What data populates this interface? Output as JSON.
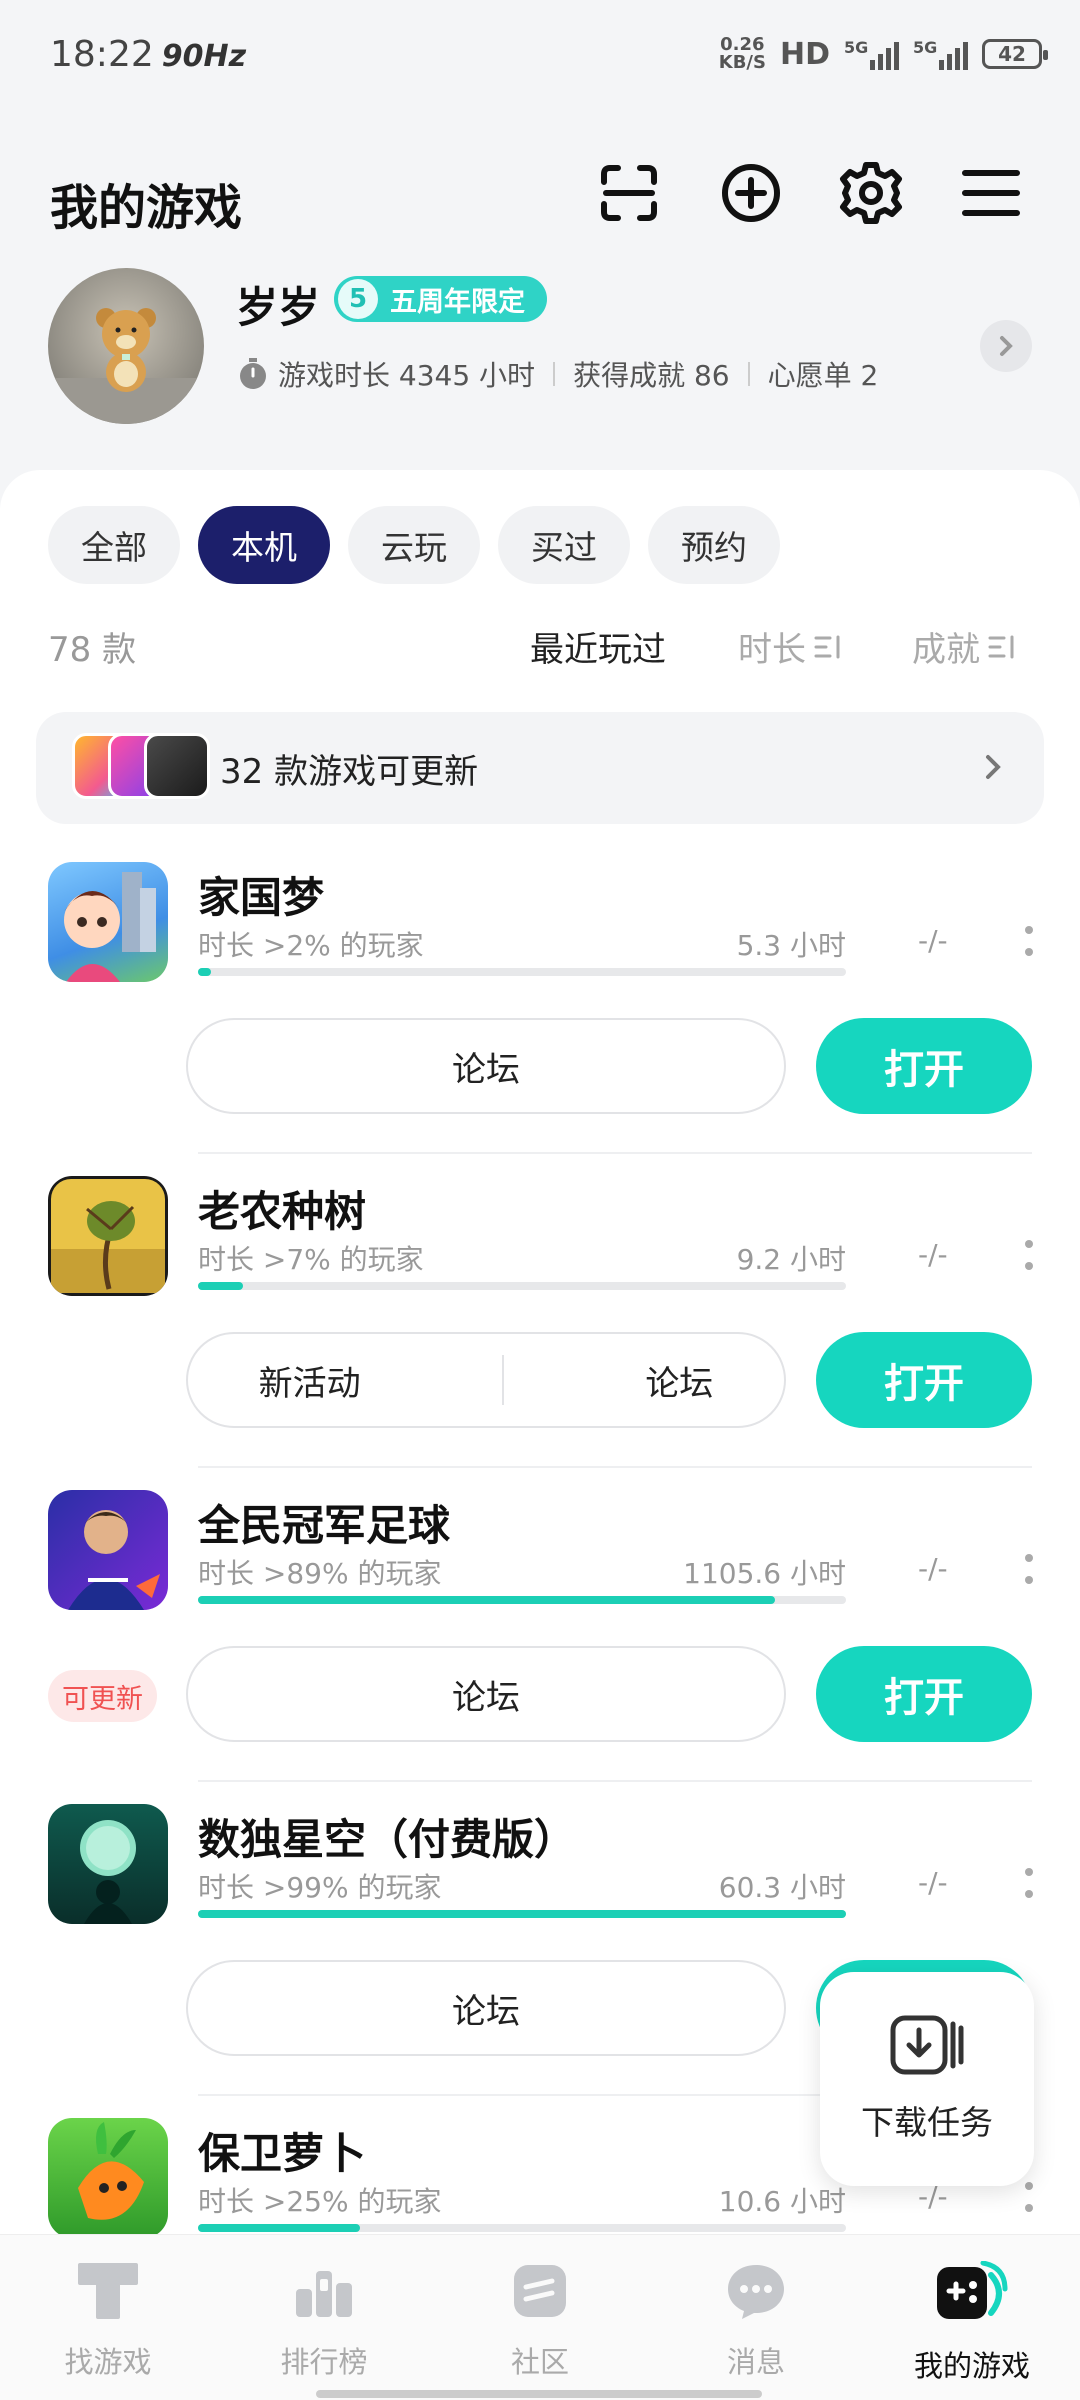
{
  "status_bar": {
    "time": "18:22",
    "refresh": "90Hz",
    "net_speed_value": "0.26",
    "net_speed_unit": "KB/S",
    "hd": "HD",
    "signal_1": "5G",
    "signal_2": "5G",
    "battery": "42"
  },
  "header": {
    "title": "我的游戏",
    "icons": [
      "scan-icon",
      "add-icon",
      "settings-icon",
      "menu-icon"
    ]
  },
  "profile": {
    "username": "岁岁",
    "badge_number": "5",
    "badge_label": "五周年限定",
    "play_time": "游戏时长 4345 小时",
    "achievements": "获得成就 86",
    "wishlist": "心愿单 2"
  },
  "tabs": [
    {
      "label": "全部",
      "active": false
    },
    {
      "label": "本机",
      "active": true
    },
    {
      "label": "云玩",
      "active": false
    },
    {
      "label": "买过",
      "active": false
    },
    {
      "label": "预约",
      "active": false
    }
  ],
  "list_meta": {
    "count": "78 款",
    "sort_recent": "最近玩过",
    "sort_duration": "时长",
    "sort_achievement": "成就"
  },
  "update_banner": {
    "text": "32 款游戏可更新"
  },
  "games": [
    {
      "name": "家国梦",
      "rank": "时长 >2% 的玩家",
      "hours": "5.3 小时",
      "achievement": "-/-",
      "progress": 0.02,
      "actions": [
        "论坛"
      ],
      "open": "打开",
      "update_tag": null
    },
    {
      "name": "老农种树",
      "rank": "时长 >7% 的玩家",
      "hours": "9.2 小时",
      "achievement": "-/-",
      "progress": 0.07,
      "actions": [
        "新活动",
        "论坛"
      ],
      "open": "打开",
      "update_tag": null
    },
    {
      "name": "全民冠军足球",
      "rank": "时长 >89% 的玩家",
      "hours": "1105.6 小时",
      "achievement": "-/-",
      "progress": 0.89,
      "actions": [
        "论坛"
      ],
      "open": "打开",
      "update_tag": "可更新"
    },
    {
      "name": "数独星空（付费版）",
      "rank": "时长 >99% 的玩家",
      "hours": "60.3 小时",
      "achievement": "-/-",
      "progress": 1.0,
      "actions": [
        "论坛"
      ],
      "open": "打开",
      "update_tag": null
    },
    {
      "name": "保卫萝卜",
      "rank": "时长 >25% 的玩家",
      "hours": "10.6 小时",
      "achievement": "-/-",
      "progress": 0.25,
      "actions": [],
      "open": "",
      "update_tag": null
    }
  ],
  "download_card": {
    "label": "下载任务"
  },
  "bottom_nav": [
    {
      "label": "找游戏",
      "icon": "find-game-icon",
      "active": false
    },
    {
      "label": "排行榜",
      "icon": "leaderboard-icon",
      "active": false
    },
    {
      "label": "社区",
      "icon": "community-icon",
      "active": false
    },
    {
      "label": "消息",
      "icon": "message-icon",
      "active": false
    },
    {
      "label": "我的游戏",
      "icon": "my-games-icon",
      "active": true
    }
  ],
  "colors": {
    "accent": "#16d6bf",
    "tab_active": "#1c1f6b",
    "badge": "#2fd3c6",
    "update_tag": "#f05252"
  }
}
